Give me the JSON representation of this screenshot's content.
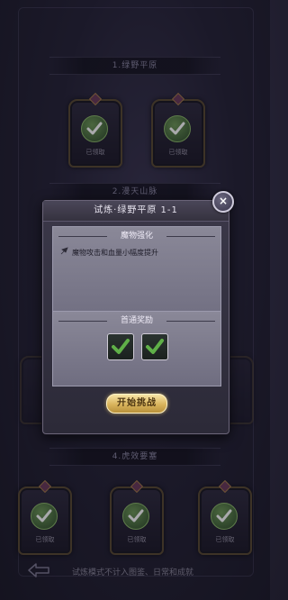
{
  "sections": [
    {
      "title": "1.绿野平原"
    },
    {
      "title": "2.漫天山脉"
    },
    {
      "title": "4.虎效要塞"
    }
  ],
  "node_labels": {
    "cleared": "已领取"
  },
  "dialog": {
    "title": "试炼·绿野平原 1-1",
    "close_label": "×",
    "effect_header": "魔物强化",
    "effect_text": "魔物攻击和血量小幅度提升",
    "reward_header": "首通奖励",
    "start_button": "开始挑战"
  },
  "footer": {
    "note": "试炼模式不计入图鉴、日常和成就"
  },
  "colors": {
    "accent_gold": "#d9b45c",
    "check_green": "#5fb048"
  }
}
